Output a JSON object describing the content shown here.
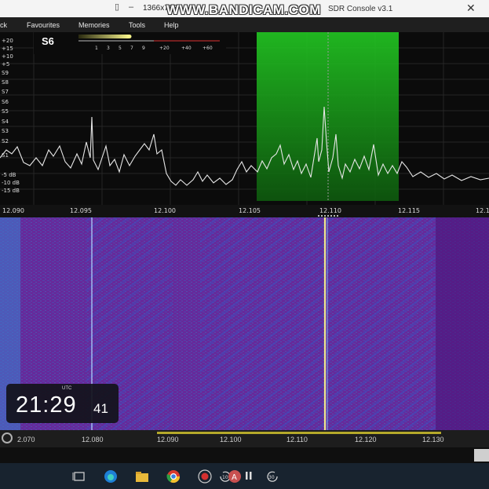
{
  "window": {
    "resolution": "1366x768",
    "watermark": "WWW.BANDICAM.COM",
    "title": "SDR Console v3.1"
  },
  "menu": {
    "items": [
      "ck",
      "Favourites",
      "Memories",
      "Tools",
      "Help"
    ]
  },
  "smeter": {
    "reading": "S6",
    "scale": [
      "1",
      "3",
      "5",
      "7",
      "9",
      "+20",
      "+40",
      "+60"
    ]
  },
  "spectrum": {
    "y_labels": [
      "+20",
      "+15",
      "+10",
      "+5",
      "S9",
      "S8",
      "S7",
      "S6",
      "S5",
      "S4",
      "S3",
      "S2",
      "S1",
      "-5 dB",
      "-10 dB",
      "-15 dB"
    ],
    "freq_labels": [
      "12.090",
      "12.095",
      "12.100",
      "12.105",
      "12.110",
      "12.115",
      "12.1"
    ],
    "filter_color": "#1fae1f"
  },
  "waterfall": {
    "background": "#5a1a8c",
    "scale_labels": [
      "2.070",
      "12.080",
      "12.090",
      "12.100",
      "12.110",
      "12.120",
      "12.130"
    ],
    "clock": {
      "zone": "UTC",
      "hm": "21:29",
      "sec": "41"
    }
  },
  "taskbar": {
    "icons": [
      "task-view-icon",
      "edge-icon",
      "file-explorer-icon",
      "chrome-icon",
      "record-icon",
      "bandicam-icon",
      "back-10-icon",
      "pause-icon",
      "forward-30-icon"
    ],
    "back_label": "10",
    "fwd_label": "30"
  }
}
